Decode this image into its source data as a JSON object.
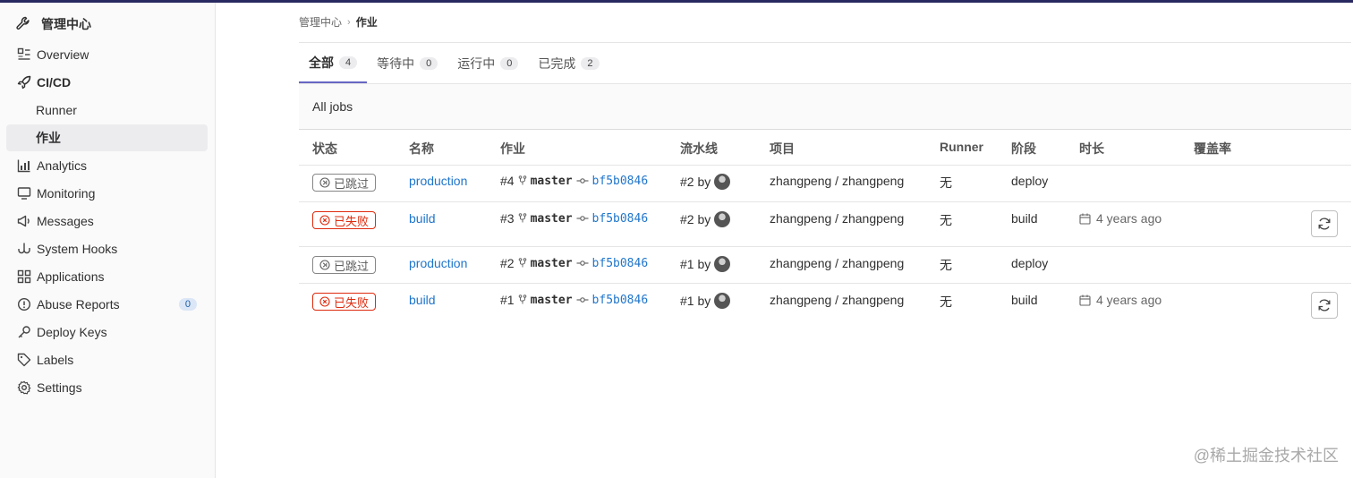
{
  "sidebar": {
    "header": "管理中心",
    "items": [
      {
        "label": "Overview",
        "icon": "overview-icon"
      },
      {
        "label": "CI/CD",
        "icon": "rocket-icon"
      },
      {
        "label": "Runner"
      },
      {
        "label": "作业"
      },
      {
        "label": "Analytics",
        "icon": "chart-icon"
      },
      {
        "label": "Monitoring",
        "icon": "monitor-icon"
      },
      {
        "label": "Messages",
        "icon": "messages-icon"
      },
      {
        "label": "System Hooks",
        "icon": "hook-icon"
      },
      {
        "label": "Applications",
        "icon": "applications-icon"
      },
      {
        "label": "Abuse Reports",
        "icon": "abuse-icon",
        "count": "0"
      },
      {
        "label": "Deploy Keys",
        "icon": "key-icon"
      },
      {
        "label": "Labels",
        "icon": "label-icon"
      },
      {
        "label": "Settings",
        "icon": "settings-icon"
      }
    ]
  },
  "breadcrumb": {
    "parent": "管理中心",
    "sep": "›",
    "current": "作业"
  },
  "tabs": [
    {
      "label": "全部",
      "count": "4"
    },
    {
      "label": "等待中",
      "count": "0"
    },
    {
      "label": "运行中",
      "count": "0"
    },
    {
      "label": "已完成",
      "count": "2"
    }
  ],
  "section_title": "All jobs",
  "columns": [
    "状态",
    "名称",
    "作业",
    "流水线",
    "项目",
    "Runner",
    "阶段",
    "时长",
    "覆盖率"
  ],
  "rows": [
    {
      "status": "已跳过",
      "status_kind": "skipped",
      "name": "production",
      "job": "#4",
      "branch": "master",
      "sha": "bf5b0846",
      "pipeline": "#2 by",
      "project": "zhangpeng / zhangpeng",
      "runner": "无",
      "stage": "deploy",
      "duration": ""
    },
    {
      "status": "已失败",
      "status_kind": "failed",
      "name": "build",
      "job": "#3",
      "branch": "master",
      "sha": "bf5b0846",
      "pipeline": "#2 by",
      "project": "zhangpeng / zhangpeng",
      "runner": "无",
      "stage": "build",
      "duration": "4 years ago"
    },
    {
      "status": "已跳过",
      "status_kind": "skipped",
      "name": "production",
      "job": "#2",
      "branch": "master",
      "sha": "bf5b0846",
      "pipeline": "#1 by",
      "project": "zhangpeng / zhangpeng",
      "runner": "无",
      "stage": "deploy",
      "duration": ""
    },
    {
      "status": "已失败",
      "status_kind": "failed",
      "name": "build",
      "job": "#1",
      "branch": "master",
      "sha": "bf5b0846",
      "pipeline": "#1 by",
      "project": "zhangpeng / zhangpeng",
      "runner": "无",
      "stage": "build",
      "duration": "4 years ago"
    }
  ],
  "watermark": "@稀土掘金技术社区",
  "colors": {
    "accent": "#6666c4",
    "link": "#1f75cb",
    "failed": "#dd2b0e",
    "topbar": "#292961"
  }
}
